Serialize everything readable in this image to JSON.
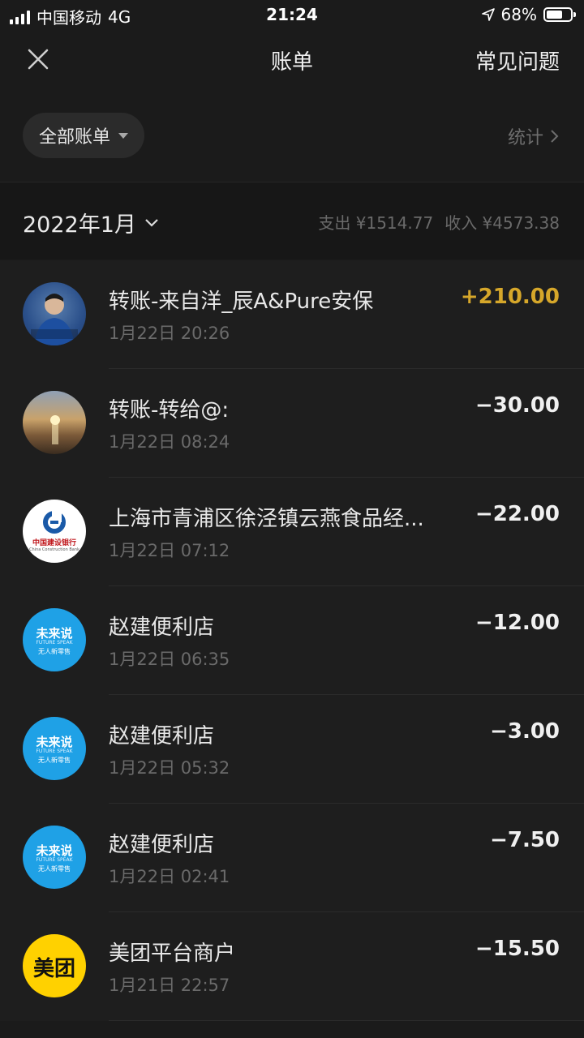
{
  "status": {
    "carrier": "中国移动",
    "network": "4G",
    "time": "21:24",
    "battery": "68%",
    "battery_level": 0.68
  },
  "nav": {
    "title": "账单",
    "faq": "常见问题"
  },
  "filter": {
    "label": "全部账单",
    "stats": "统计"
  },
  "month": {
    "title": "2022年1月",
    "expense": "支出 ¥1514.77",
    "income": "收入 ¥4573.38"
  },
  "transactions": [
    {
      "name": "转账-来自洋_辰A&Pure安保",
      "time": "1月22日 20:26",
      "amount": "+210.00",
      "avatar": "person-photo"
    },
    {
      "name": "转账-转给@:",
      "time": "1月22日 08:24",
      "amount": "−30.00",
      "avatar": "sunset-photo"
    },
    {
      "name": "上海市青浦区徐泾镇云燕食品经...",
      "time": "1月22日 07:12",
      "amount": "−22.00",
      "avatar": "ccb-logo"
    },
    {
      "name": "赵建便利店",
      "time": "1月22日 06:35",
      "amount": "−12.00",
      "avatar": "future-speak-logo"
    },
    {
      "name": "赵建便利店",
      "time": "1月22日 05:32",
      "amount": "−3.00",
      "avatar": "future-speak-logo"
    },
    {
      "name": "赵建便利店",
      "time": "1月22日 02:41",
      "amount": "−7.50",
      "avatar": "future-speak-logo"
    },
    {
      "name": "美团平台商户",
      "time": "1月21日 22:57",
      "amount": "−15.50",
      "avatar": "meituan-logo"
    }
  ],
  "logos": {
    "ccb_cn": "中国建设银行",
    "ccb_en": "China Construction Bank",
    "future_cn": "未来说",
    "future_en": "FUTURE SPEAK",
    "future_sub": "无人新零售",
    "meituan": "美团"
  },
  "colors": {
    "background": "#1b1b1b",
    "income": "#d6a72a",
    "expense": "#f0f0f0",
    "muted": "#6a6a6a"
  }
}
